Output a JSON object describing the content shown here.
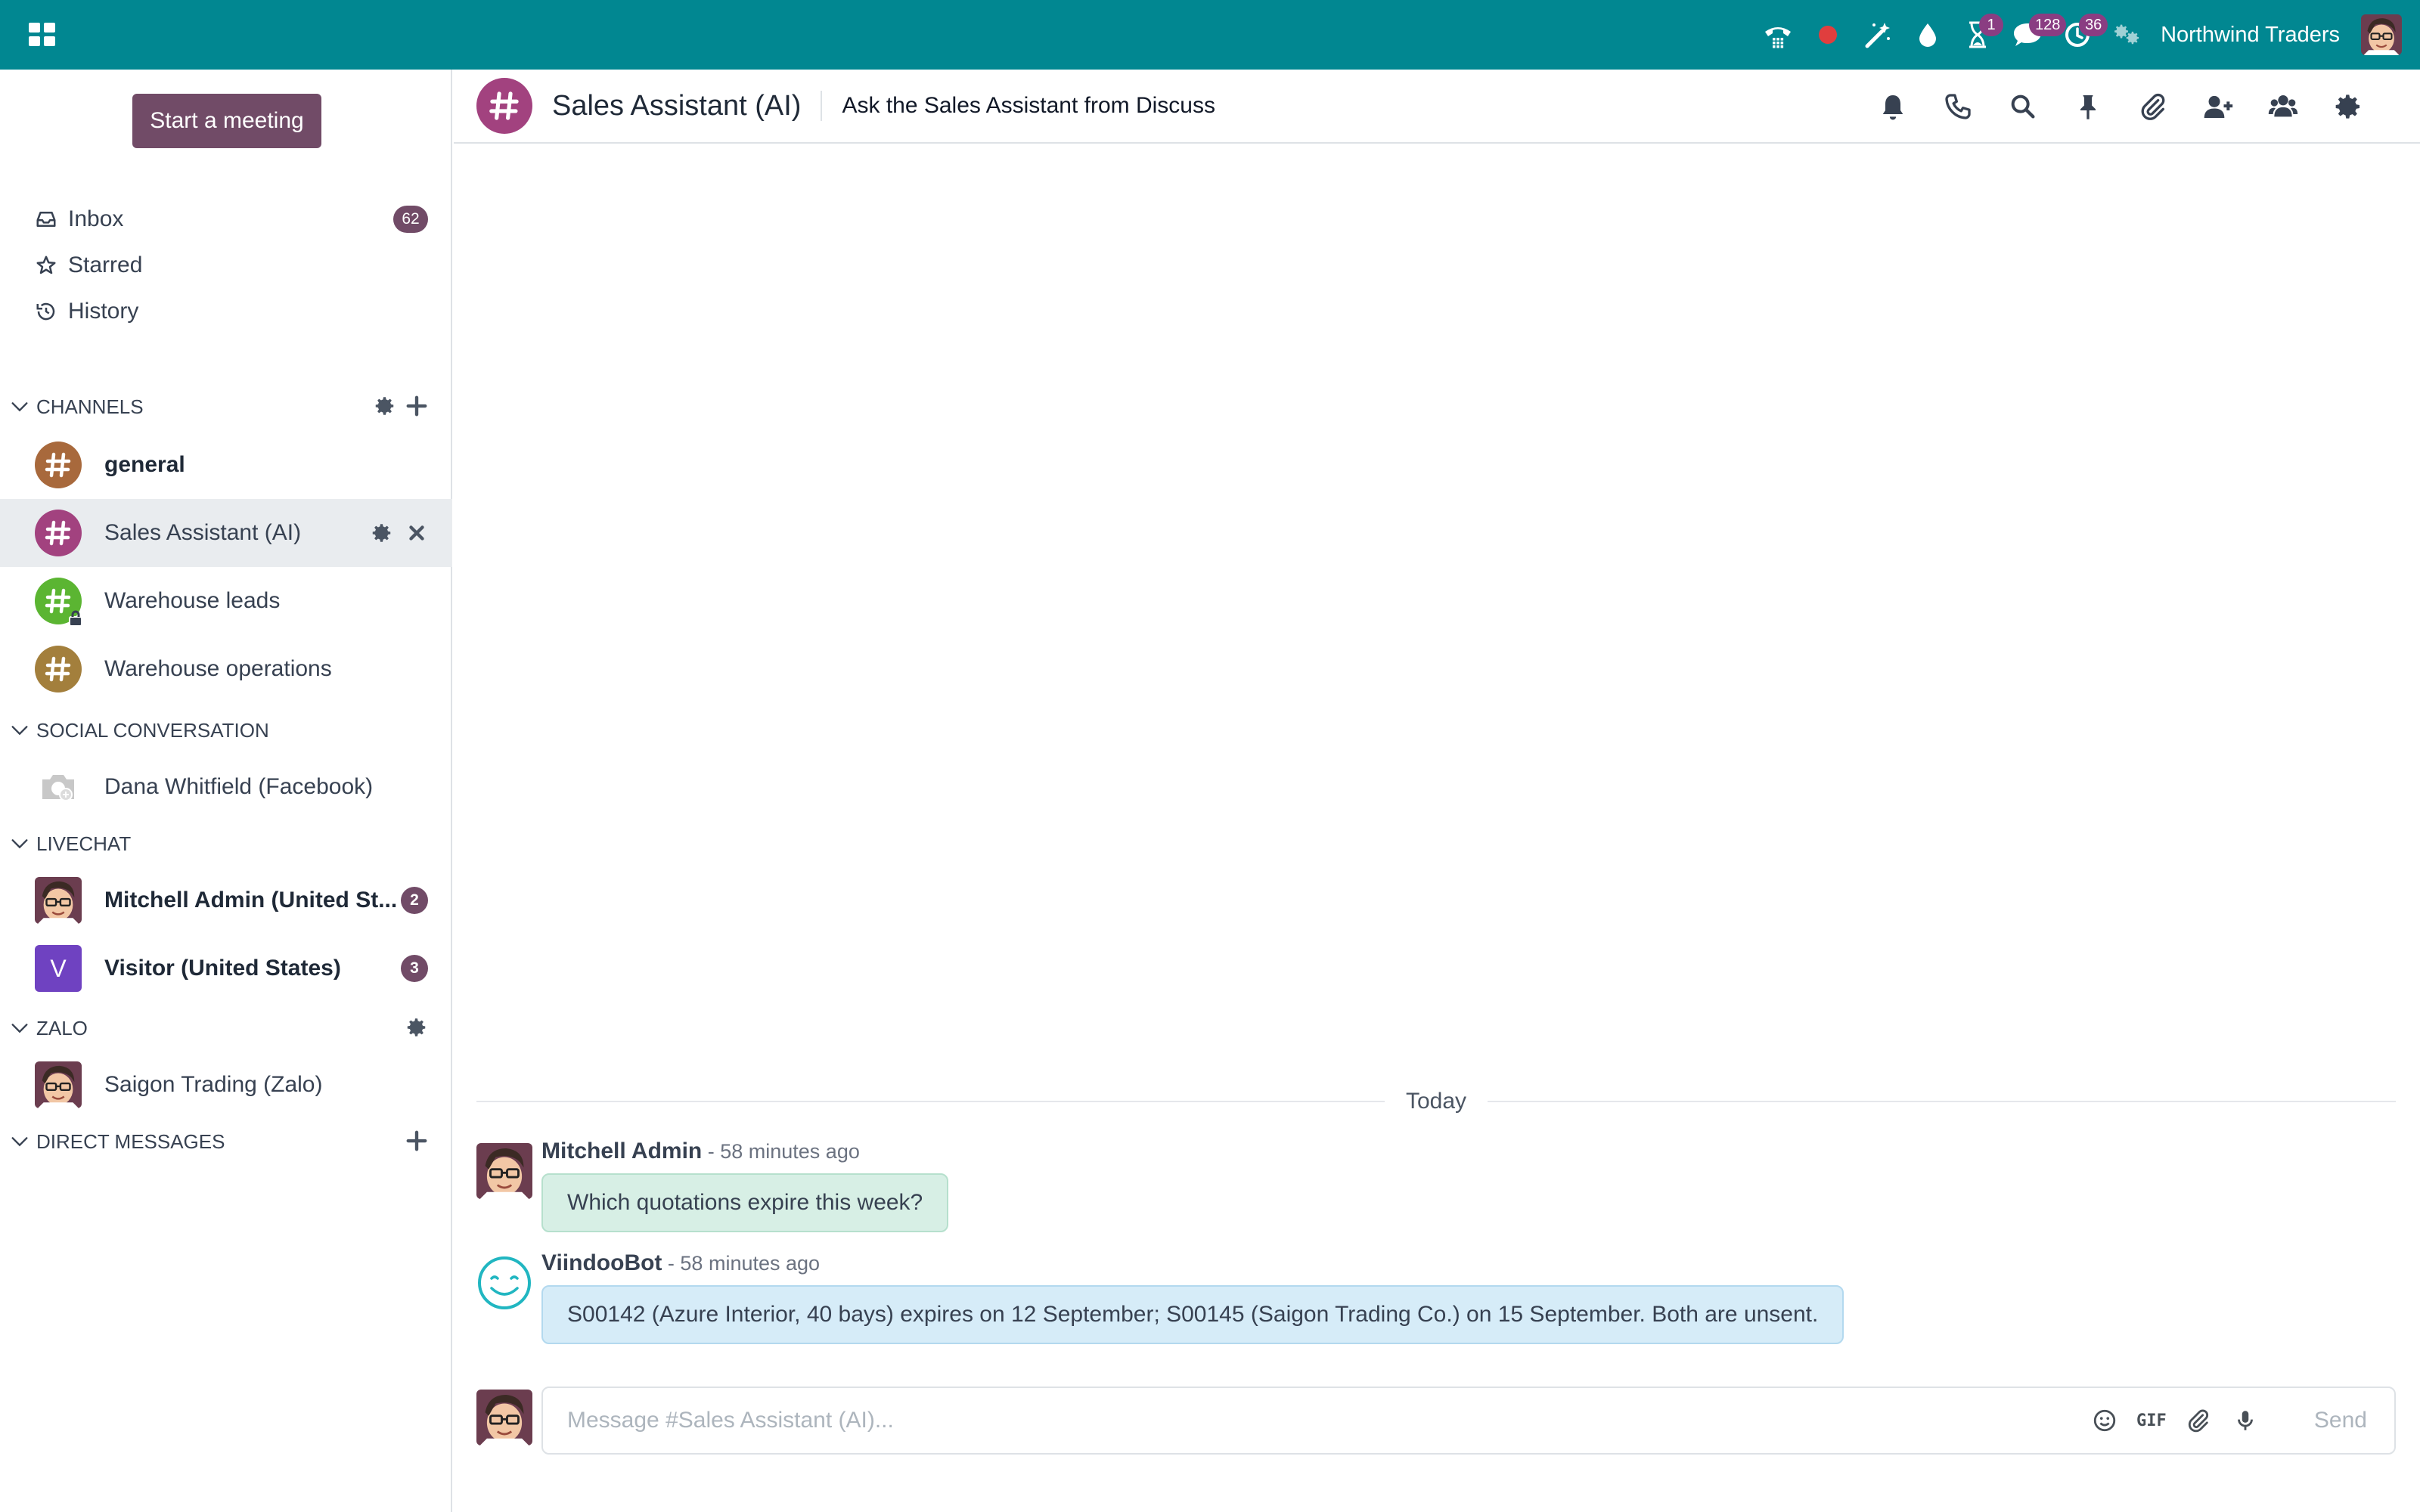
{
  "colors": {
    "navbar": "#018791",
    "brand": "#714b67",
    "badge": "#8a3d82"
  },
  "topbar": {
    "apps_icon": "apps-grid-icon",
    "tray": [
      {
        "name": "voip-phone-icon",
        "badge": ""
      },
      {
        "name": "recording-dot-icon",
        "badge": ""
      },
      {
        "name": "magic-wand-icon",
        "badge": ""
      },
      {
        "name": "water-drop-icon",
        "badge": ""
      },
      {
        "name": "hourglass-icon",
        "badge": "1"
      },
      {
        "name": "messaging-icon",
        "badge": "128"
      },
      {
        "name": "activity-clock-icon",
        "badge": "36"
      },
      {
        "name": "company-switch-icon",
        "badge": ""
      }
    ],
    "company_name": "Northwind Traders"
  },
  "sidebar": {
    "start_meeting": "Start a meeting",
    "mailboxes": [
      {
        "label": "Inbox",
        "icon": "inbox-icon",
        "count": "62"
      },
      {
        "label": "Starred",
        "icon": "star-icon",
        "count": ""
      },
      {
        "label": "History",
        "icon": "history-icon",
        "count": ""
      }
    ],
    "categories": {
      "channels": "CHANNELS",
      "social": "SOCIAL CONVERSATION",
      "livechat": "LIVECHAT",
      "zalo": "ZALO",
      "direct": "DIRECT MESSAGES"
    },
    "channels": [
      {
        "label": "general",
        "color": "#a8693c"
      },
      {
        "label": "Sales Assistant (AI)",
        "color": "#a2427f"
      },
      {
        "label": "Warehouse leads",
        "color": "#5bb532"
      },
      {
        "label": "Warehouse operations",
        "color": "#a37f3c"
      }
    ],
    "social": [
      {
        "label": "Dana Whitfield (Facebook)"
      }
    ],
    "livechat": [
      {
        "label": "Mitchell Admin (United St...",
        "count": "2"
      },
      {
        "label": "Visitor (United States)",
        "count": "3",
        "initial": "V"
      }
    ],
    "zalo": [
      {
        "label": "Saigon Trading (Zalo)"
      }
    ]
  },
  "thread": {
    "title": "Sales Assistant (AI)",
    "description": "Ask the Sales Assistant from Discuss",
    "actions": [
      "notification-bell-icon",
      "call-icon",
      "search-icon",
      "pin-icon",
      "attachments-icon",
      "add-users-icon",
      "members-icon",
      "settings-gear-icon"
    ],
    "date_separator": "Today",
    "messages": [
      {
        "author": "Mitchell Admin",
        "time": " - 58 minutes ago",
        "body": "Which quotations expire this week?"
      },
      {
        "author": "ViindooBot",
        "time": " - 58 minutes ago",
        "body": "S00142 (Azure Interior, 40 bays) expires on 12 September; S00145 (Saigon Trading Co.) on 15 September. Both are unsent."
      }
    ]
  },
  "composer": {
    "placeholder": "Message #Sales Assistant (AI)...",
    "gif_label": "GIF",
    "send_label": "Send"
  }
}
